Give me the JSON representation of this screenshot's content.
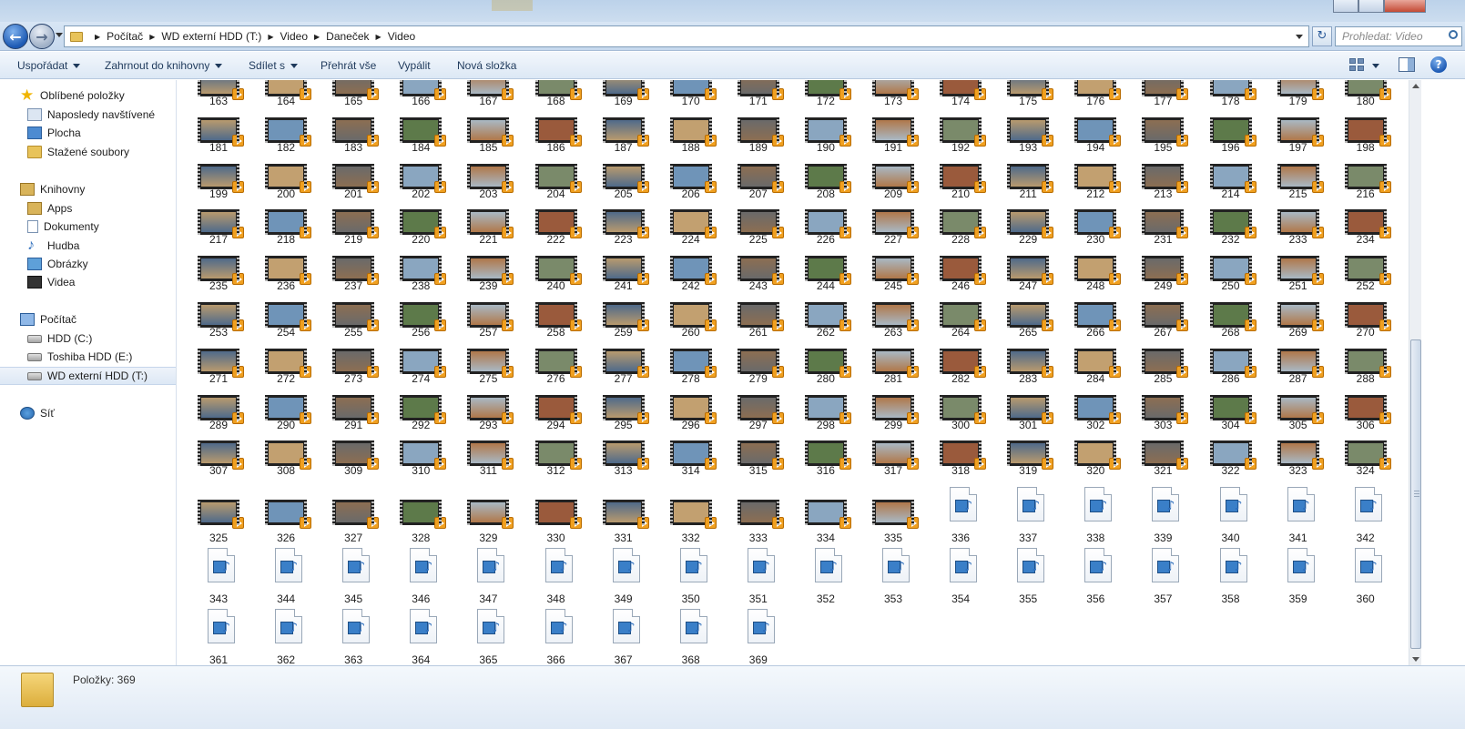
{
  "address": {
    "crumbs": [
      "Počítač",
      "WD externí HDD (T:)",
      "Video",
      "Daneček",
      "Video"
    ]
  },
  "search": {
    "placeholder": "Prohledat: Video"
  },
  "toolbar": {
    "organize": "Uspořádat",
    "include_in_library": "Zahrnout do knihovny",
    "share_with": "Sdílet s",
    "play_all": "Přehrát vše",
    "burn": "Vypálit",
    "new_folder": "Nová složka"
  },
  "nav": {
    "favorites": {
      "title": "Oblíbené položky",
      "items": [
        {
          "label": "Naposledy navštívené",
          "icon": "recent-places-icon"
        },
        {
          "label": "Plocha",
          "icon": "desktop-icon"
        },
        {
          "label": "Stažené soubory",
          "icon": "downloads-folder-icon"
        }
      ]
    },
    "libraries": {
      "title": "Knihovny",
      "items": [
        {
          "label": "Apps",
          "icon": "apps-library-icon"
        },
        {
          "label": "Dokumenty",
          "icon": "documents-library-icon"
        },
        {
          "label": "Hudba",
          "icon": "music-library-icon"
        },
        {
          "label": "Obrázky",
          "icon": "pictures-library-icon"
        },
        {
          "label": "Videa",
          "icon": "videos-library-icon"
        }
      ]
    },
    "computer": {
      "title": "Počítač",
      "items": [
        {
          "label": "HDD (C:)",
          "icon": "system-drive-icon"
        },
        {
          "label": "Toshiba HDD (E:)",
          "icon": "drive-icon"
        },
        {
          "label": "WD externí HDD (T:)",
          "icon": "drive-icon",
          "selected": true
        }
      ]
    },
    "network": {
      "title": "Síť"
    }
  },
  "files": {
    "first": 163,
    "last": 369,
    "last_video_thumbnail": 335
  },
  "status": {
    "items_count": "Položky: 369"
  }
}
